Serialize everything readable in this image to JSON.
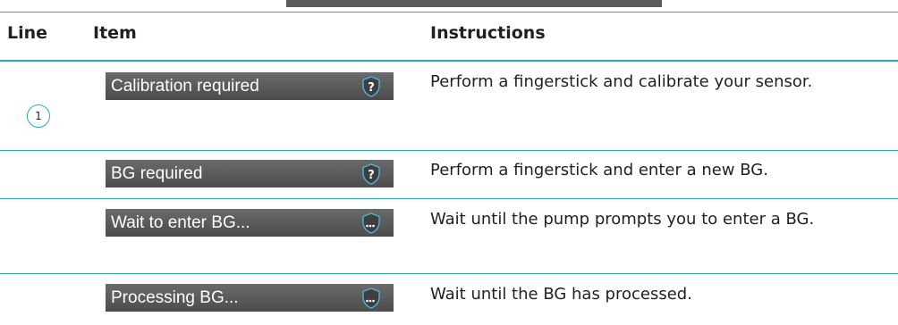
{
  "header": {
    "line": "Line",
    "item": "Item",
    "instructions": "Instructions"
  },
  "line_number": "1",
  "rows": [
    {
      "screen_text": "Calibration required",
      "icon": "shield-question-icon",
      "instructions": "Perform a fingerstick and calibrate your sensor."
    },
    {
      "screen_text": "BG required",
      "icon": "shield-question-icon",
      "instructions": "Perform a fingerstick and enter a new BG."
    },
    {
      "screen_text": "Wait to enter BG...",
      "icon": "shield-ellipsis-icon",
      "instructions": "Wait until the pump prompts you to enter a BG."
    },
    {
      "screen_text": "Processing BG...",
      "icon": "shield-ellipsis-icon",
      "instructions": "Wait until the BG has processed."
    }
  ],
  "colors": {
    "rule": "#2aa8c4",
    "screen_bg": "#5a5a5a",
    "screen_text": "#ffffff",
    "icon_accent": "#4fb3d9"
  }
}
